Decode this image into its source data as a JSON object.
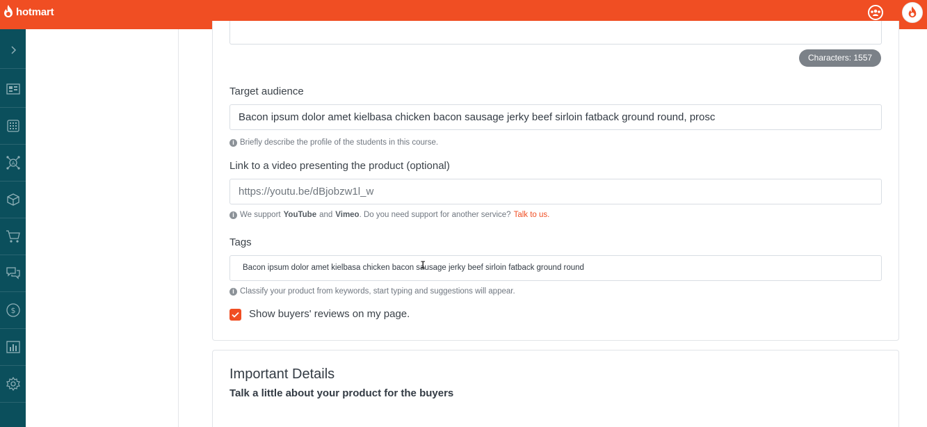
{
  "brand": {
    "name": "hotmart",
    "color": "#f04e23"
  },
  "topbar": {
    "icons": [
      "community-icon",
      "user-avatar-icon"
    ]
  },
  "sidebar": {
    "items": [
      {
        "icon": "expand-chevron-icon"
      },
      {
        "icon": "dashboard-icon"
      },
      {
        "icon": "apps-grid-icon"
      },
      {
        "icon": "affiliates-network-icon"
      },
      {
        "icon": "product-box-icon"
      },
      {
        "icon": "cart-icon"
      },
      {
        "icon": "chat-icon"
      },
      {
        "icon": "money-icon"
      },
      {
        "icon": "analytics-icon"
      },
      {
        "icon": "settings-icon"
      }
    ]
  },
  "description": {
    "char_count_label": "Characters: 1557"
  },
  "target_audience": {
    "label": "Target audience",
    "value": "Bacon ipsum dolor amet kielbasa chicken bacon sausage jerky beef sirloin fatback ground round, prosc",
    "hint": "Briefly describe the profile of the students in this course."
  },
  "video_link": {
    "label": "Link to a video presenting the product (optional)",
    "value": "https://youtu.be/dBjobzw1l_w",
    "hint_prefix": "We support",
    "hint_youtube": "YouTube",
    "hint_and": "and",
    "hint_vimeo": "Vimeo",
    "hint_suffix": ". Do you need support for another service?",
    "hint_link": "Talk to us."
  },
  "tags": {
    "label": "Tags",
    "value": "Bacon ipsum dolor amet kielbasa chicken bacon sausage jerky beef sirloin fatback ground round",
    "hint": "Classify your product from keywords, start typing and suggestions will appear."
  },
  "reviews": {
    "label": "Show buyers' reviews on my page.",
    "checked": true
  },
  "important_details": {
    "title": "Important Details",
    "subtitle": "Talk a little about your product for the buyers"
  }
}
